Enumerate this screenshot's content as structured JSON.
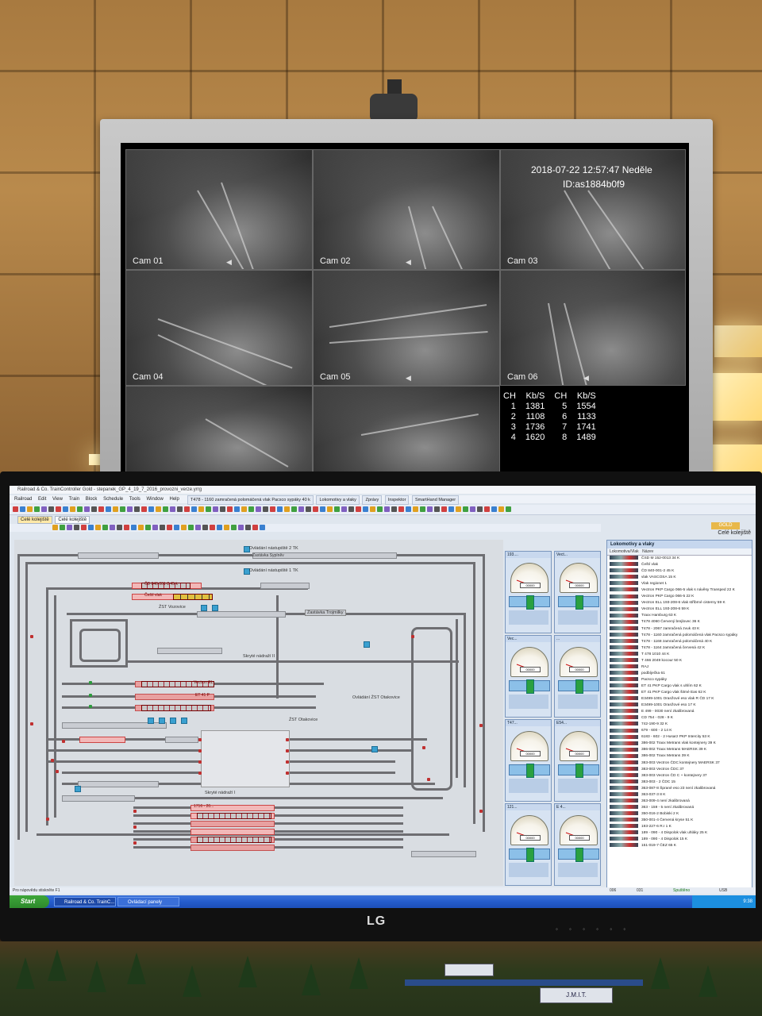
{
  "cctv": {
    "datetime": "2018-07-22 12:57:47 Neděle",
    "device_id": "ID:as1884b0f9",
    "cameras": [
      "Cam 01",
      "Cam 02",
      "Cam 03",
      "Cam 04",
      "Cam 05",
      "Cam 06",
      "",
      ""
    ],
    "stats_headers": [
      "CH",
      "Kb/S",
      "CH",
      "Kb/S"
    ],
    "stats_rows": [
      [
        "1",
        "1381",
        "5",
        "1554"
      ],
      [
        "2",
        "1108",
        "6",
        "1133"
      ],
      [
        "3",
        "1736",
        "7",
        "1741"
      ],
      [
        "4",
        "1620",
        "8",
        "1489"
      ]
    ]
  },
  "app": {
    "title": "Railroad & Co. TrainController Gold - stepanek_GP_4_19_7_2016_provozni_verze.yrrg",
    "menu": [
      "Railroad",
      "Edit",
      "View",
      "Train",
      "Block",
      "Schedule",
      "Tools",
      "Window",
      "Help"
    ],
    "window_tabs": [
      "T478 - 1160 zamračená polomáčená vlak Pacsco sypáky 40 k",
      "Lokomotivy a vlaky",
      "Zprávy",
      "Inspektor",
      "SmartHand Manager"
    ],
    "doc_tabs": [
      "Celé kolejiště",
      "Celé kolejiště"
    ],
    "right_title": "Celé kolejiště",
    "gold_badge": "GOLD"
  },
  "layout_labels": {
    "ovldani_2tk": "Ovládání nástupiště 2 TK",
    "zastavka_sypnev": "Zastávka Sypíněv",
    "ovldani_1tk": "Ovládání nástupiště 1 TK",
    "cd_train": "ČD 840 001-2  45 k",
    "cesti_train": "Čeští vlak",
    "zst_vozovice": "ŽST Vozovice",
    "zastavka_trojmilky": "Zastávka Trojmilky",
    "skryte_nadrazi_2": "Skryté nádraží II",
    "vectron_el": "Vectron EL",
    "et41": "ET 41 P",
    "ovldani_zst": "Ovládání ŽST Otakovice",
    "zst_otakovice": "ŽST Otakovice",
    "skryte_nadrazi_1": "Skryté nádraží I",
    "block_1716": "1716 - 20..."
  },
  "control_panels": [
    {
      "title": "193....",
      "odo": "00000",
      "speed_label": "km/h"
    },
    {
      "title": "Vect...",
      "odo": "00000",
      "speed_label": "km/h"
    },
    {
      "title": "Vec...",
      "odo": "00000",
      "speed_label": "km/h"
    },
    {
      "title": "...",
      "odo": "00000",
      "speed_label": "km/h"
    },
    {
      "title": "T47...",
      "odo": "00000",
      "speed_label": "km/h"
    },
    {
      "title": "E54...",
      "odo": "00000",
      "speed_label": "km/h"
    },
    {
      "title": "121...",
      "odo": "00000",
      "speed_label": "km/h"
    },
    {
      "title": "E 4...",
      "odo": "00000",
      "speed_label": "km/h"
    }
  ],
  "loco_list": {
    "title": "Lokomotivy a vlaky",
    "columns": [
      "Lokomotiva/Vlak",
      "Název"
    ],
    "rows": [
      "ČSD M 152-0013  34 K",
      "Čeští vlak",
      "ČD 840-001-2  45 K",
      "vlak VASCOSA       15 K",
      "Vlak regionet    1",
      "Vectron PKP Cargo 066-5  vlak s návěsy Transped   22 K",
      "Vectron PKP Cargo 066-5    22 K",
      "Vectron ELL 193-208-6  vlak stříbrné cisterny  59 K",
      "Vectron ELL 193-208-6    59 K",
      "Traxx Hamburg 63 K",
      "T478 4060 Červený brejlovec  36 K",
      "T478 - 2067 zamračená zvuk 43 K",
      "T478 - 1160 zamračená polomáčená vlak Pacsco sypáky",
      "T478 - 1168 zamračená polomáčená 40 K",
      "T478 - 1164 zamračená červená  42 K",
      "T 478 1010  44 K",
      "T 466 2049 kocour 50 K",
      "RAJ",
      "podbíječka 61",
      "Pacsco sypáky",
      "ET 41 PKP Cargo vlak s uhlím   62 K",
      "ET 41 PKP Cargo  vlak šitmé Eas  62 K",
      "E3499-1001  Oranžové eso  vlak R ČD   17 K",
      "E3499-1001  Oranžové eso    17 K",
      "E 499 - 0030 není zkalibrovaná",
      "CD 754 - 028 - 9 K",
      "742-190-9      32 K",
      "679 - 600 - 2    14 K",
      "6183 - 602 - 2 Husarz PKP Intercity  53 K",
      "386-002 Traxx Metrans  vlak kontejnery  39 K",
      "386-002 Traxx Metrans  MAERSK  39 K",
      "386-002 Traxx Metrans    39 K",
      "383-003 Vectron ČDC kontejnery MAERSK 37",
      "383-003 Vectron ČDC 37",
      "383-003 Vectron ČD C + kontejnery 37",
      "383-003 - 2  ČDC 15",
      "363-087-8 Šprané eso 23 není zkalibrovaná",
      "363-037-3    8 K",
      "363-009-4 není zkalibrovaná",
      "363 - 159 - 5 není zkalibrovaná",
      "350-016-2 Bobiski  2 K",
      "350-001-4 Červená kryse   51 K",
      "193-227-6 R.I  1 K",
      "189 - 090 - 4 Dispolok vlak uhláky  25 K",
      "189 - 090 - 4 Dispolok  15 K",
      "151-019-7 ČEZ 65 K"
    ]
  },
  "status": {
    "help": "Pro nápovědu stiskněte F1",
    "c1": "006",
    "c2": "031",
    "mode": "Spuštěno",
    "usb": "USB"
  },
  "taskbar": {
    "start": "Start",
    "tasks": [
      "Railroad & Co. TrainC...",
      "Ovládací panely"
    ],
    "clock": "9:38"
  },
  "monitor_brand": "LG",
  "scene": {
    "truck_text": "J.M.I.T."
  }
}
